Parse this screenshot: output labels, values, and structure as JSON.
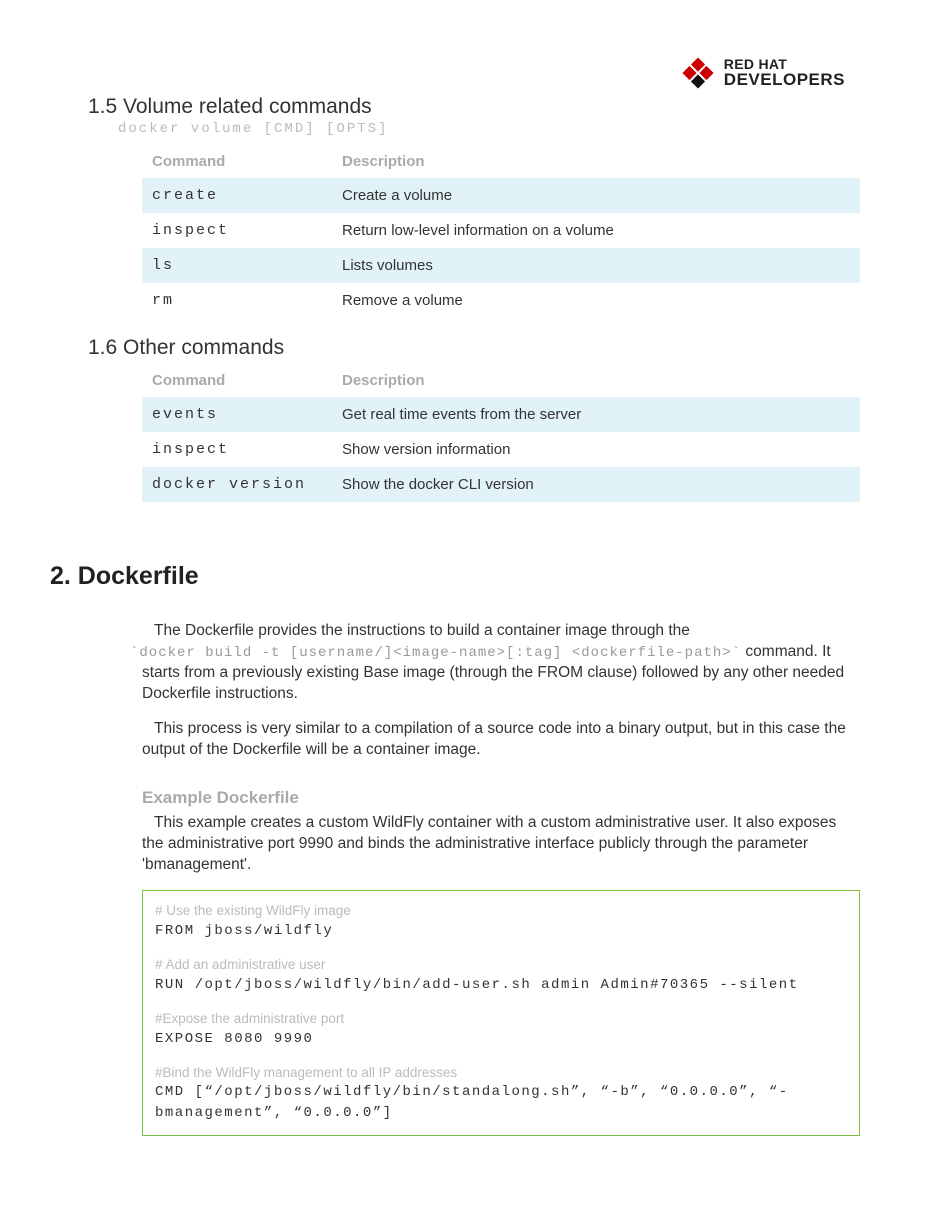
{
  "logo": {
    "line1": "RED HAT",
    "line2": "DEVELOPERS"
  },
  "section15": {
    "title": "1.5 Volume related commands",
    "cmdline": "docker volume [CMD] [OPTS]",
    "headers": {
      "c1": "Command",
      "c2": "Description"
    },
    "rows": [
      {
        "cmd": "create",
        "desc": "Create a volume"
      },
      {
        "cmd": "inspect",
        "desc": "Return low-level information on a volume"
      },
      {
        "cmd": "ls",
        "desc": "Lists volumes"
      },
      {
        "cmd": "rm",
        "desc": "Remove a volume"
      }
    ]
  },
  "section16": {
    "title": "1.6 Other commands",
    "headers": {
      "c1": "Command",
      "c2": "Description"
    },
    "rows": [
      {
        "cmd": "events",
        "desc": "Get real time events from the server"
      },
      {
        "cmd": "inspect",
        "desc": "Show version information"
      },
      {
        "cmd": "docker version",
        "desc": "Show the docker CLI version"
      }
    ]
  },
  "dockerfile": {
    "title": "2. Dockerfile",
    "p1a": "The Dockerfile provides the instructions to build a container image through the ",
    "p1code": "`docker build -t [username/]<image-name>[:tag] <dockerfile-path>`",
    "p1b": " command. It starts from a previously existing Base image (through the FROM clause) followed by any other needed Dockerfile instructions.",
    "p2": "This process is very similar to a compilation of a source code into a binary output, but in this case the output of the Dockerfile will be a container image.",
    "example_title": "Example Dockerfile",
    "p3": "This example creates a custom WildFly container with a custom administrative user. It also exposes the administrative port 9990 and binds the administrative interface publicly through the parameter 'bmanagement'.",
    "code": {
      "b1c": "# Use the existing WildFly image",
      "b1l": "FROM jboss/wildfly",
      "b2c": "# Add an administrative user",
      "b2l": "RUN /opt/jboss/wildfly/bin/add-user.sh admin Admin#70365 --silent",
      "b3c": "#Expose the administrative port",
      "b3l": "EXPOSE 8080 9990",
      "b4c": "#Bind the WildFly management to all IP addresses",
      "b4l": "CMD [“/opt/jboss/wildfly/bin/standalong.sh”, “-b”, “0.0.0.0”, “-bmanagement”, “0.0.0.0”]"
    }
  }
}
